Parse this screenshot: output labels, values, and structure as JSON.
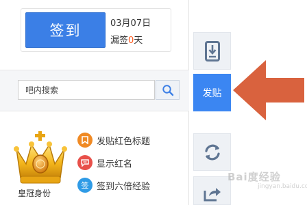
{
  "signin": {
    "button_label": "签到",
    "date": "03月07日",
    "missed_prefix": "漏签",
    "missed_count": "0",
    "missed_suffix": "天"
  },
  "search": {
    "placeholder": "吧内搜索"
  },
  "member": {
    "badge_label": "皇冠身份",
    "perks": [
      {
        "label": "发贴红色标题",
        "icon": "bookmark-icon",
        "color": "#f08a24"
      },
      {
        "label": "显示红名",
        "icon": "chat-icon",
        "color": "#e8504a"
      },
      {
        "label": "签到六倍经验",
        "icon": "sign-icon",
        "color": "#2f9be6",
        "glyph": "签"
      }
    ]
  },
  "sidebar": {
    "post_label": "发贴"
  },
  "colors": {
    "primary_blue": "#3b7fe6",
    "post_blue": "#3b86f2",
    "arrow": "#d9623e",
    "missed_red": "#ff5a1f"
  },
  "watermark": {
    "text": "Bai度经验",
    "sub": "jingyan.baidu.com"
  }
}
